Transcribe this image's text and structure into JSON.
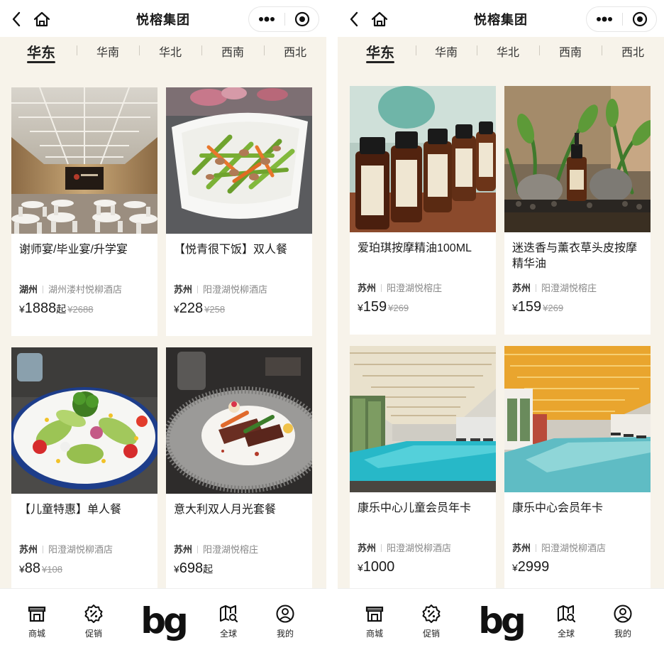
{
  "header": {
    "title": "悦榕集团"
  },
  "regions": [
    "华东",
    "华南",
    "华北",
    "西南",
    "西北"
  ],
  "tabbar": {
    "shop": "商城",
    "promo": "促销",
    "logo": "bg",
    "global": "全球",
    "mine": "我的"
  },
  "left_products": [
    {
      "name": "谢师宴/毕业宴/升学宴",
      "city": "湖州",
      "hotel": "湖州溇村悦柳酒店",
      "currency": "¥",
      "price": "1888",
      "suffix": "起",
      "original": "¥2688",
      "image": "banquet-hall"
    },
    {
      "name": "【悦青很下饭】双人餐",
      "city": "苏州",
      "hotel": "阳澄湖悦柳酒店",
      "currency": "¥",
      "price": "228",
      "suffix": "",
      "original": "¥258",
      "image": "stir-fry-dish"
    },
    {
      "name": "【儿童特惠】单人餐",
      "city": "苏州",
      "hotel": "阳澄湖悦柳酒店",
      "currency": "¥",
      "price": "88",
      "suffix": "",
      "original": "¥108",
      "image": "salad-plate"
    },
    {
      "name": "意大利双人月光套餐",
      "city": "苏州",
      "hotel": "阳澄湖悦榕庄",
      "currency": "¥",
      "price": "698",
      "suffix": "起",
      "original": "",
      "image": "steak-plate"
    }
  ],
  "right_products": [
    {
      "name": "爱珀琪按摩精油100ML",
      "city": "苏州",
      "hotel": "阳澄湖悦榕庄",
      "currency": "¥",
      "price": "159",
      "suffix": "",
      "original": "¥269",
      "image": "oil-bottles"
    },
    {
      "name": "迷迭香与薰衣草头皮按摩精华油",
      "city": "苏州",
      "hotel": "阳澄湖悦榕庄",
      "currency": "¥",
      "price": "159",
      "suffix": "",
      "original": "¥269",
      "image": "serum-bottle-plants"
    },
    {
      "name": "康乐中心儿童会员年卡",
      "city": "苏州",
      "hotel": "阳澄湖悦柳酒店",
      "currency": "¥",
      "price": "1000",
      "suffix": "",
      "original": "",
      "image": "indoor-pool"
    },
    {
      "name": "康乐中心会员年卡",
      "city": "苏州",
      "hotel": "阳澄湖悦柳酒店",
      "currency": "¥",
      "price": "2999",
      "suffix": "",
      "original": "",
      "image": "indoor-pool-warm"
    }
  ],
  "colors": {
    "page_bg": "#f7f3ea",
    "card_bg": "#ffffff",
    "muted_text": "#888888",
    "strike_text": "#999999"
  }
}
